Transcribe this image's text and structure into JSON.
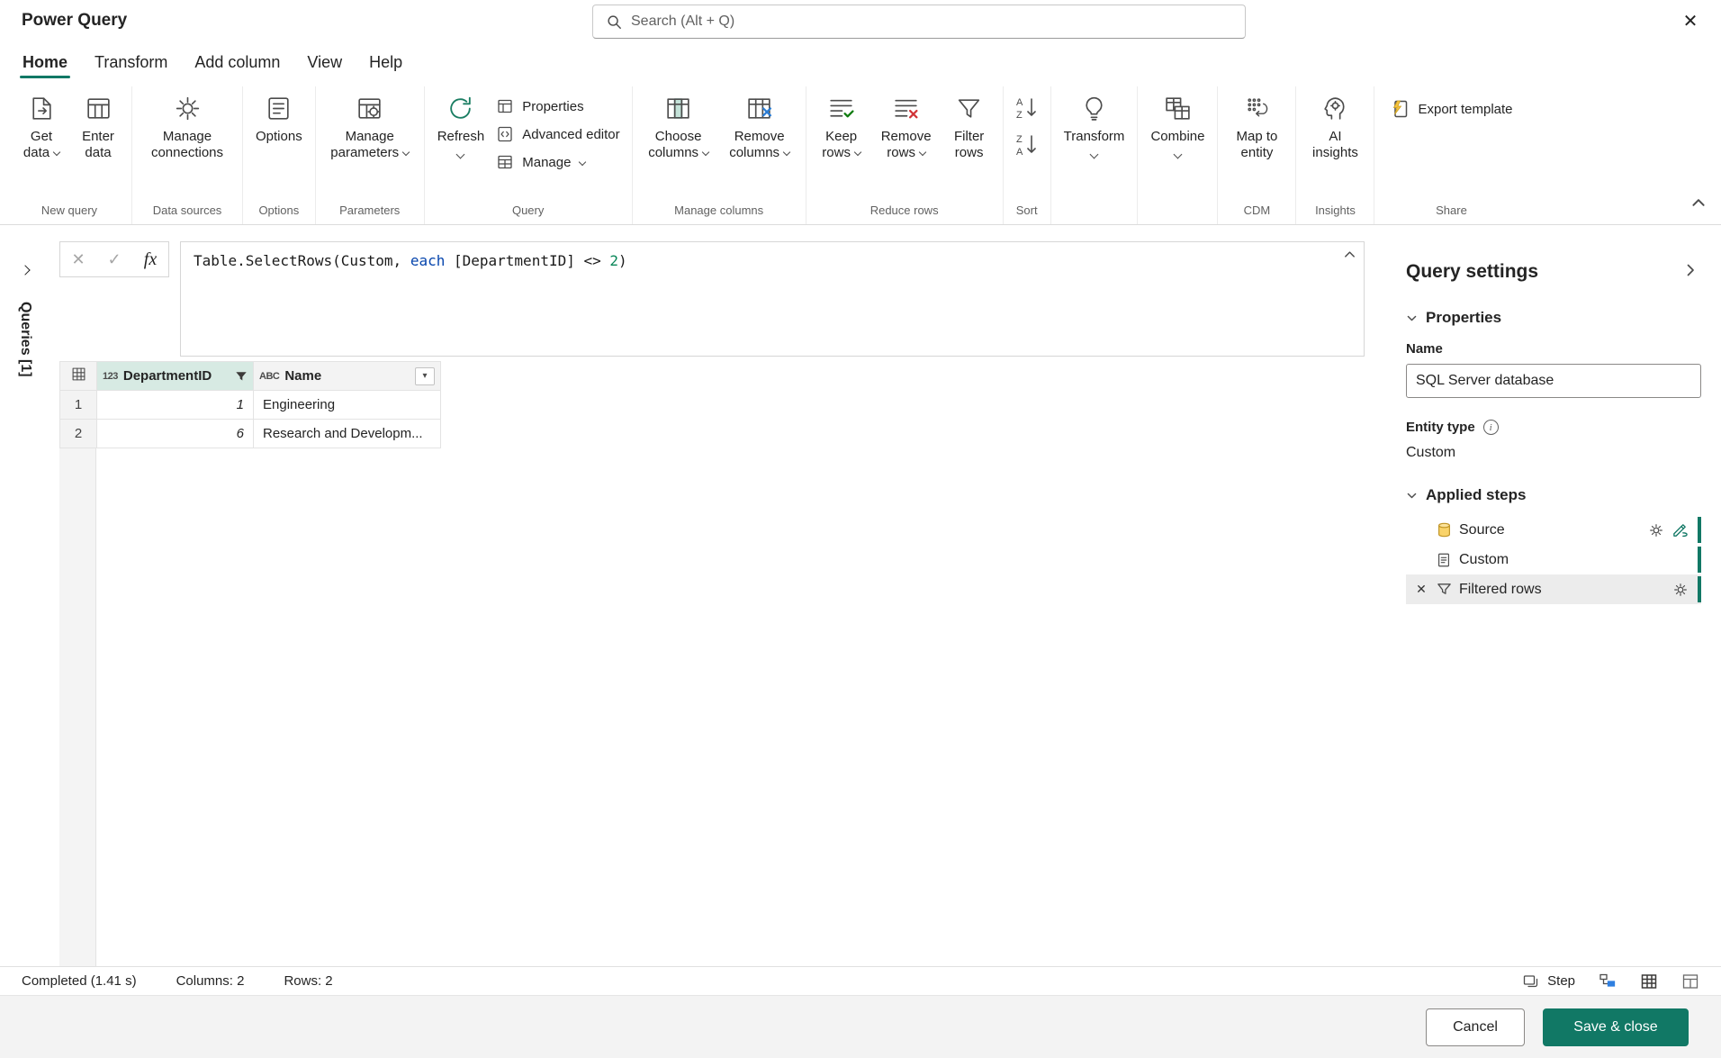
{
  "colors": {
    "accent": "#117865",
    "keyword_blue": "#0645ad",
    "number_green": "#098658",
    "step_selected_bg": "#ececec"
  },
  "icons": {
    "close": "✕",
    "check": "✓",
    "delete": "✕",
    "info": "i",
    "dropdown_arrow": "▾"
  },
  "titlebar": {
    "title": "Power Query",
    "search_placeholder": "Search (Alt + Q)"
  },
  "tabs": {
    "items": [
      {
        "label": "Home"
      },
      {
        "label": "Transform"
      },
      {
        "label": "Add column"
      },
      {
        "label": "View"
      },
      {
        "label": "Help"
      }
    ]
  },
  "ribbon": {
    "buttons": {
      "get_data": "Get data",
      "enter_data": "Enter data",
      "manage_connections": "Manage connections",
      "options": "Options",
      "manage_parameters": "Manage parameters",
      "refresh": "Refresh",
      "properties": "Properties",
      "advanced_editor": "Advanced editor",
      "manage": "Manage",
      "choose_columns": "Choose columns",
      "remove_columns": "Remove columns",
      "keep_rows": "Keep rows",
      "remove_rows": "Remove rows",
      "filter_rows": "Filter rows",
      "transform": "Transform",
      "combine": "Combine",
      "map_to_entity": "Map to entity",
      "ai_insights": "AI insights",
      "export_template": "Export template"
    },
    "group_labels": {
      "new_query": "New query",
      "data_sources": "Data sources",
      "options": "Options",
      "parameters": "Parameters",
      "query": "Query",
      "manage_columns": "Manage columns",
      "reduce_rows": "Reduce rows",
      "sort": "Sort",
      "cdm": "CDM",
      "insights": "Insights",
      "share": "Share"
    }
  },
  "queries_pane": {
    "label": "Queries [1]"
  },
  "formula_bar": {
    "fx_label": "fx",
    "tokens": [
      {
        "text": "Table.SelectRows(Custom, ",
        "type": "default"
      },
      {
        "text": "each",
        "type": "keyword"
      },
      {
        "text": " [DepartmentID] <> ",
        "type": "default"
      },
      {
        "text": "2",
        "type": "number"
      },
      {
        "text": ")",
        "type": "default"
      }
    ]
  },
  "grid": {
    "columns": [
      {
        "badge": "123",
        "label": "DepartmentID",
        "filtered": true
      },
      {
        "badge": "ABC",
        "label": "Name",
        "filtered": false
      }
    ],
    "rows": [
      {
        "num": "1",
        "cells": [
          "1",
          "Engineering"
        ]
      },
      {
        "num": "2",
        "cells": [
          "6",
          "Research and Developm..."
        ]
      }
    ]
  },
  "query_settings": {
    "title": "Query settings",
    "properties_section": "Properties",
    "name_label": "Name",
    "name_value": "SQL Server database",
    "entity_type_label": "Entity type",
    "entity_type_value": "Custom",
    "applied_steps_section": "Applied steps",
    "steps": [
      {
        "label": "Source",
        "selected": false
      },
      {
        "label": "Custom",
        "selected": false
      },
      {
        "label": "Filtered rows",
        "selected": true
      }
    ]
  },
  "statusbar": {
    "completed": "Completed (1.41 s)",
    "columns": "Columns: 2",
    "rows": "Rows: 2",
    "step": "Step"
  },
  "footer": {
    "cancel": "Cancel",
    "save": "Save & close"
  }
}
